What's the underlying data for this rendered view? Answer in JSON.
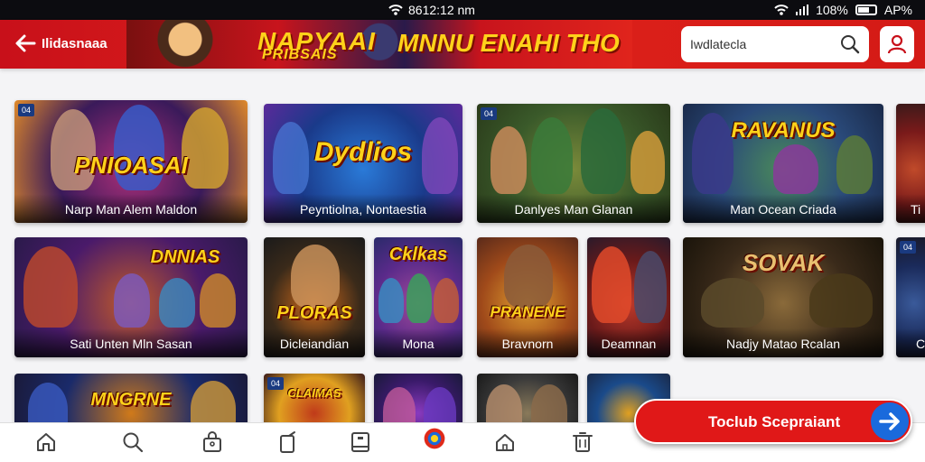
{
  "status_bar": {
    "time": "8612:12 nm",
    "battery": "108%",
    "carrier": "AP%"
  },
  "header": {
    "back_icon": "arrow-left-icon",
    "title": "Ilidasnaaa",
    "banner_text_1": "NAPYAAI",
    "banner_sub_text": "PRIBSAIS",
    "banner_text_2": "MNNU ENAHI THO",
    "search_placeholder": "Iwdlatecla",
    "profile_icon": "user-icon",
    "colors": {
      "primary": "#d41a16",
      "banner_text": "#ffd21a"
    }
  },
  "rows": [
    [
      {
        "label": "Narp Man Alem Maldon",
        "art_title": "PNIOASAI",
        "badge": "04",
        "colors": [
          "#3a1a5a",
          "#b0307a",
          "#e08a2a"
        ]
      },
      {
        "label": "Peyntiolna, Nontaestia",
        "art_title": "Dydlios",
        "colors": [
          "#1a3a8a",
          "#2a7ad8",
          "#5a2a9a"
        ]
      },
      {
        "label": "Danlyes Man Glanan",
        "art_title": "",
        "badge": "04",
        "colors": [
          "#3a5a2a",
          "#7a8a3a",
          "#2a3a1a"
        ]
      },
      {
        "label": "Man Ocean Criada",
        "art_title": "RAVANUS",
        "colors": [
          "#2a4a7a",
          "#4a8a5a",
          "#1a2a4a"
        ]
      },
      {
        "label": "Ti",
        "art_title": "",
        "colors": [
          "#7a1a1a",
          "#c04a2a",
          "#3a1a1a"
        ]
      }
    ],
    [
      {
        "label": "Sati Unten Mln Sasan",
        "art_title": "DNNIAS",
        "colors": [
          "#4a1a6a",
          "#c05a2a",
          "#2a1a4a"
        ]
      },
      {
        "label": "Dicleiandian",
        "art_title": "PLORAS",
        "colors": [
          "#3a2a1a",
          "#d06a1a",
          "#1a1a1a"
        ]
      },
      {
        "label": "Mona",
        "art_title": "Cklkas",
        "colors": [
          "#5a2a8a",
          "#a04a9a",
          "#2a2a6a"
        ]
      },
      {
        "label": "Bravnorn",
        "art_title": "PRANENE",
        "colors": [
          "#a04a1a",
          "#e0a030",
          "#5a2a1a"
        ]
      },
      {
        "label": "Deamnan",
        "art_title": "",
        "colors": [
          "#6a1a1a",
          "#c03a2a",
          "#2a1a2a"
        ]
      },
      {
        "label": "Nadjy Matao Rcalan",
        "art_title": "SOVAK",
        "colors": [
          "#3a2a1a",
          "#8a6a3a",
          "#1a140a"
        ]
      },
      {
        "label": "C",
        "art_title": "",
        "badge": "04",
        "colors": [
          "#1a2a5a",
          "#3a5a9a",
          "#1a1a2a"
        ]
      }
    ],
    [
      {
        "label": "",
        "art_title": "MNGRNE",
        "colors": [
          "#1a2a6a",
          "#d07a1a",
          "#1a1a3a"
        ]
      },
      {
        "label": "",
        "art_title": "CLAIMAS",
        "badge": "04",
        "colors": [
          "#e0a020",
          "#c03a1a",
          "#3a1a1a"
        ]
      },
      {
        "label": "",
        "art_title": "",
        "colors": [
          "#3a1a6a",
          "#8a3ac0",
          "#1a1a3a"
        ]
      },
      {
        "label": "",
        "art_title": "",
        "colors": [
          "#3a3a3a",
          "#8a7a5a",
          "#1a1a1a"
        ]
      },
      {
        "label": "",
        "art_title": "",
        "colors": [
          "#1a4a8a",
          "#e0a020",
          "#1a2a4a"
        ]
      }
    ]
  ],
  "cta": {
    "label": "Toclub Scepraiant",
    "icon": "arrow-right-icon"
  },
  "bottom_nav": [
    {
      "icon": "home-icon"
    },
    {
      "icon": "search-icon"
    },
    {
      "icon": "bag-icon"
    },
    {
      "icon": "phone-icon"
    },
    {
      "icon": "book-icon"
    },
    {
      "icon": "logo-icon",
      "active": true
    },
    {
      "icon": "house-outline-icon"
    },
    {
      "icon": "trash-icon"
    }
  ]
}
